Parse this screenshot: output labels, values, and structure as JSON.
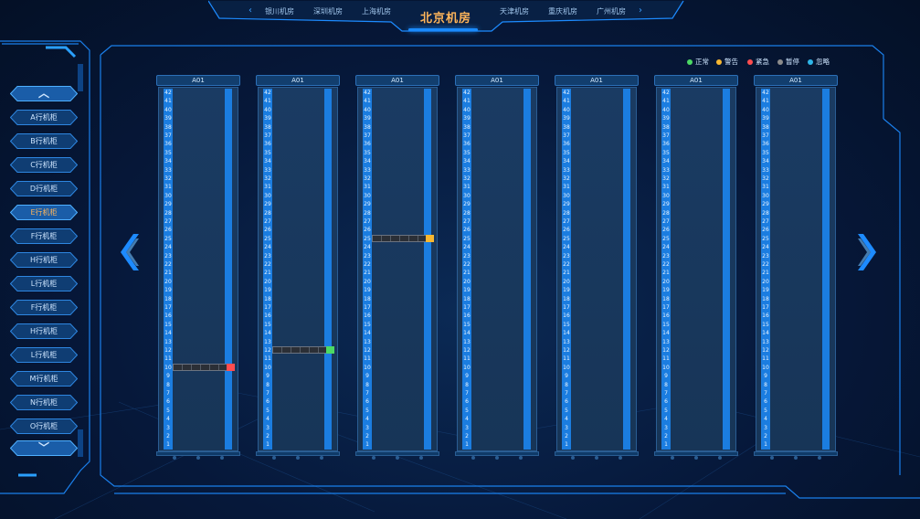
{
  "top_nav": {
    "left_arrow": "‹",
    "right_arrow": "›",
    "items": [
      "银川机房",
      "深圳机房",
      "上海机房",
      "天津机房",
      "重庆机房",
      "广州机房"
    ],
    "active": "北京机房"
  },
  "sidebar": {
    "up": "︿",
    "down": "﹀",
    "items": [
      {
        "label": "A行机柜",
        "active": false
      },
      {
        "label": "B行机柜",
        "active": false
      },
      {
        "label": "C行机柜",
        "active": false
      },
      {
        "label": "D行机柜",
        "active": false
      },
      {
        "label": "E行机柜",
        "active": true
      },
      {
        "label": "F行机柜",
        "active": false
      },
      {
        "label": "H行机柜",
        "active": false
      },
      {
        "label": "L行机柜",
        "active": false
      },
      {
        "label": "F行机柜",
        "active": false
      },
      {
        "label": "H行机柜",
        "active": false
      },
      {
        "label": "L行机柜",
        "active": false
      },
      {
        "label": "M行机柜",
        "active": false
      },
      {
        "label": "N行机柜",
        "active": false
      },
      {
        "label": "O行机柜",
        "active": false
      }
    ]
  },
  "legend": [
    {
      "label": "正常",
      "color": "#4cd964"
    },
    {
      "label": "警告",
      "color": "#f7b731"
    },
    {
      "label": "紧急",
      "color": "#ff4d4f"
    },
    {
      "label": "暂停",
      "color": "#8c8c8c"
    },
    {
      "label": "忽略",
      "color": "#2fb6e8"
    }
  ],
  "racks": [
    {
      "name": "A01",
      "units": 42,
      "devices": [
        {
          "u": 10,
          "status_color": "#ff4d4f"
        }
      ]
    },
    {
      "name": "A01",
      "units": 42,
      "devices": [
        {
          "u": 12,
          "status_color": "#4cd964"
        }
      ]
    },
    {
      "name": "A01",
      "units": 42,
      "devices": [
        {
          "u": 25,
          "status_color": "#f7b731"
        }
      ]
    },
    {
      "name": "A01",
      "units": 42,
      "devices": []
    },
    {
      "name": "A01",
      "units": 42,
      "devices": []
    },
    {
      "name": "A01",
      "units": 42,
      "devices": []
    },
    {
      "name": "A01",
      "units": 42,
      "devices": []
    }
  ]
}
